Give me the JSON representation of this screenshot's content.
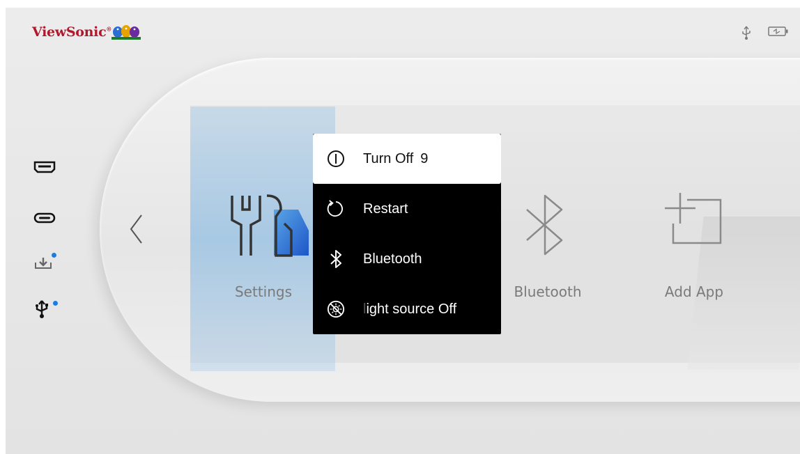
{
  "brand": {
    "name": "ViewSonic",
    "trademark": "®"
  },
  "status_icons": [
    "usb-status-icon",
    "battery-icon"
  ],
  "sidebar": {
    "items": [
      {
        "icon": "hdmi-icon"
      },
      {
        "icon": "usb-c-icon"
      },
      {
        "icon": "download-icon",
        "notification": true
      },
      {
        "icon": "usb-icon",
        "notification": true
      }
    ]
  },
  "apps": [
    {
      "label": "Settings",
      "icon": "settings-icon"
    },
    {
      "label": "Bluetooth",
      "icon": "bluetooth-icon"
    },
    {
      "label": "Add App",
      "icon": "add-app-icon"
    }
  ],
  "power_menu": {
    "items": [
      {
        "label": "Turn Off",
        "countdown": "9",
        "icon": "power-icon",
        "selected": true
      },
      {
        "label": "Restart",
        "icon": "restart-icon"
      },
      {
        "label": "Bluetooth",
        "icon": "bluetooth-icon"
      },
      {
        "label_prefix": "l",
        "label": "ight source Off",
        "icon": "light-source-icon"
      }
    ]
  },
  "colors": {
    "brand_red": "#b0182c",
    "notification_dot": "#1c7de0",
    "menu_bg": "#000000",
    "menu_selected_bg": "#ffffff",
    "focus_tile": "#8cbee6"
  }
}
